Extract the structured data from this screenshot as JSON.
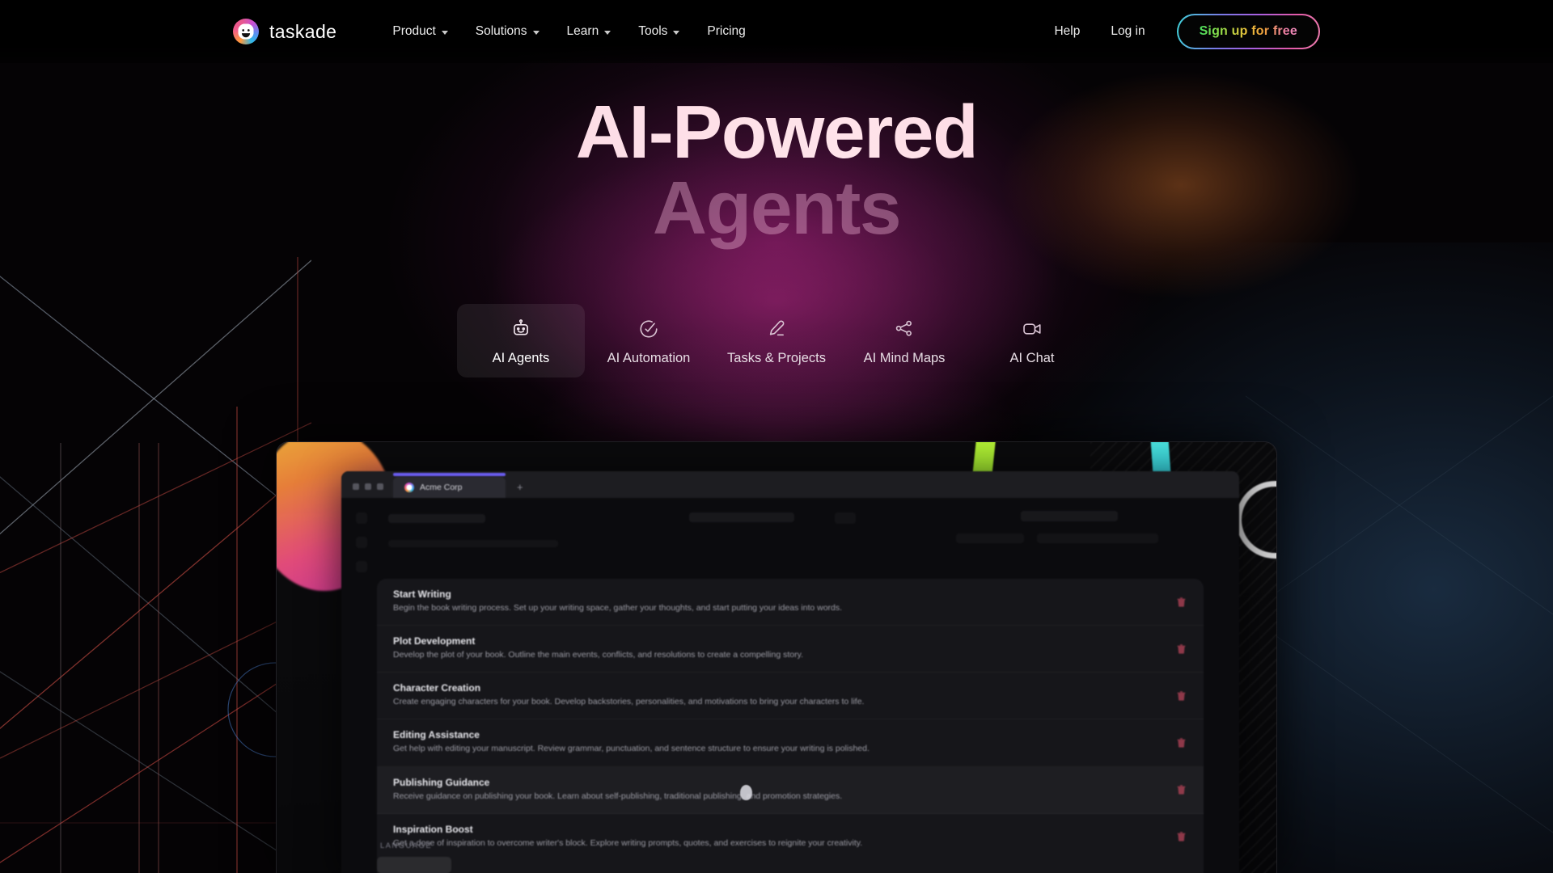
{
  "brand": {
    "name": "taskade",
    "logo_icon": "taskade-logo-icon",
    "accent_gradient": [
      "#3fd3d8",
      "#a95fe0",
      "#f07fb0"
    ]
  },
  "nav": {
    "items": [
      {
        "label": "Product",
        "has_dropdown": true
      },
      {
        "label": "Solutions",
        "has_dropdown": true
      },
      {
        "label": "Learn",
        "has_dropdown": true
      },
      {
        "label": "Tools",
        "has_dropdown": true
      },
      {
        "label": "Pricing",
        "has_dropdown": false
      }
    ],
    "right": [
      {
        "label": "Help"
      },
      {
        "label": "Log in"
      }
    ],
    "cta": {
      "label": "Sign up for free"
    }
  },
  "hero": {
    "title_line1": "AI-Powered",
    "title_line2": "Agents"
  },
  "tabs": [
    {
      "label": "AI Agents",
      "icon": "robot-icon",
      "active": true
    },
    {
      "label": "AI Automation",
      "icon": "check-circle-icon",
      "active": false
    },
    {
      "label": "Tasks & Projects",
      "icon": "pen-icon",
      "active": false
    },
    {
      "label": "AI Mind Maps",
      "icon": "share-nodes-icon",
      "active": false
    },
    {
      "label": "AI Chat",
      "icon": "video-camera-icon",
      "active": false
    }
  ],
  "product_shot": {
    "browser": {
      "tab_title": "Acme Corp",
      "new_tab_label": "+",
      "accent_color": "#6a5cf0"
    },
    "commands": [
      {
        "title": "Start Writing",
        "desc": "Begin the book writing process. Set up your writing space, gather your thoughts, and start putting your ideas into words."
      },
      {
        "title": "Plot Development",
        "desc": "Develop the plot of your book. Outline the main events, conflicts, and resolutions to create a compelling story."
      },
      {
        "title": "Character Creation",
        "desc": "Create engaging characters for your book. Develop backstories, personalities, and motivations to bring your characters to life."
      },
      {
        "title": "Editing Assistance",
        "desc": "Get help with editing your manuscript. Review grammar, punctuation, and sentence structure to ensure your writing is polished."
      },
      {
        "title": "Publishing Guidance",
        "desc": "Receive guidance on publishing your book. Learn about self-publishing, traditional publishing, and promotion strategies."
      },
      {
        "title": "Inspiration Boost",
        "desc": "Get a dose of inspiration to overcome writer's block. Explore writing prompts, quotes, and exercises to reignite your creativity."
      }
    ],
    "language_label": "LANGUAGE"
  }
}
